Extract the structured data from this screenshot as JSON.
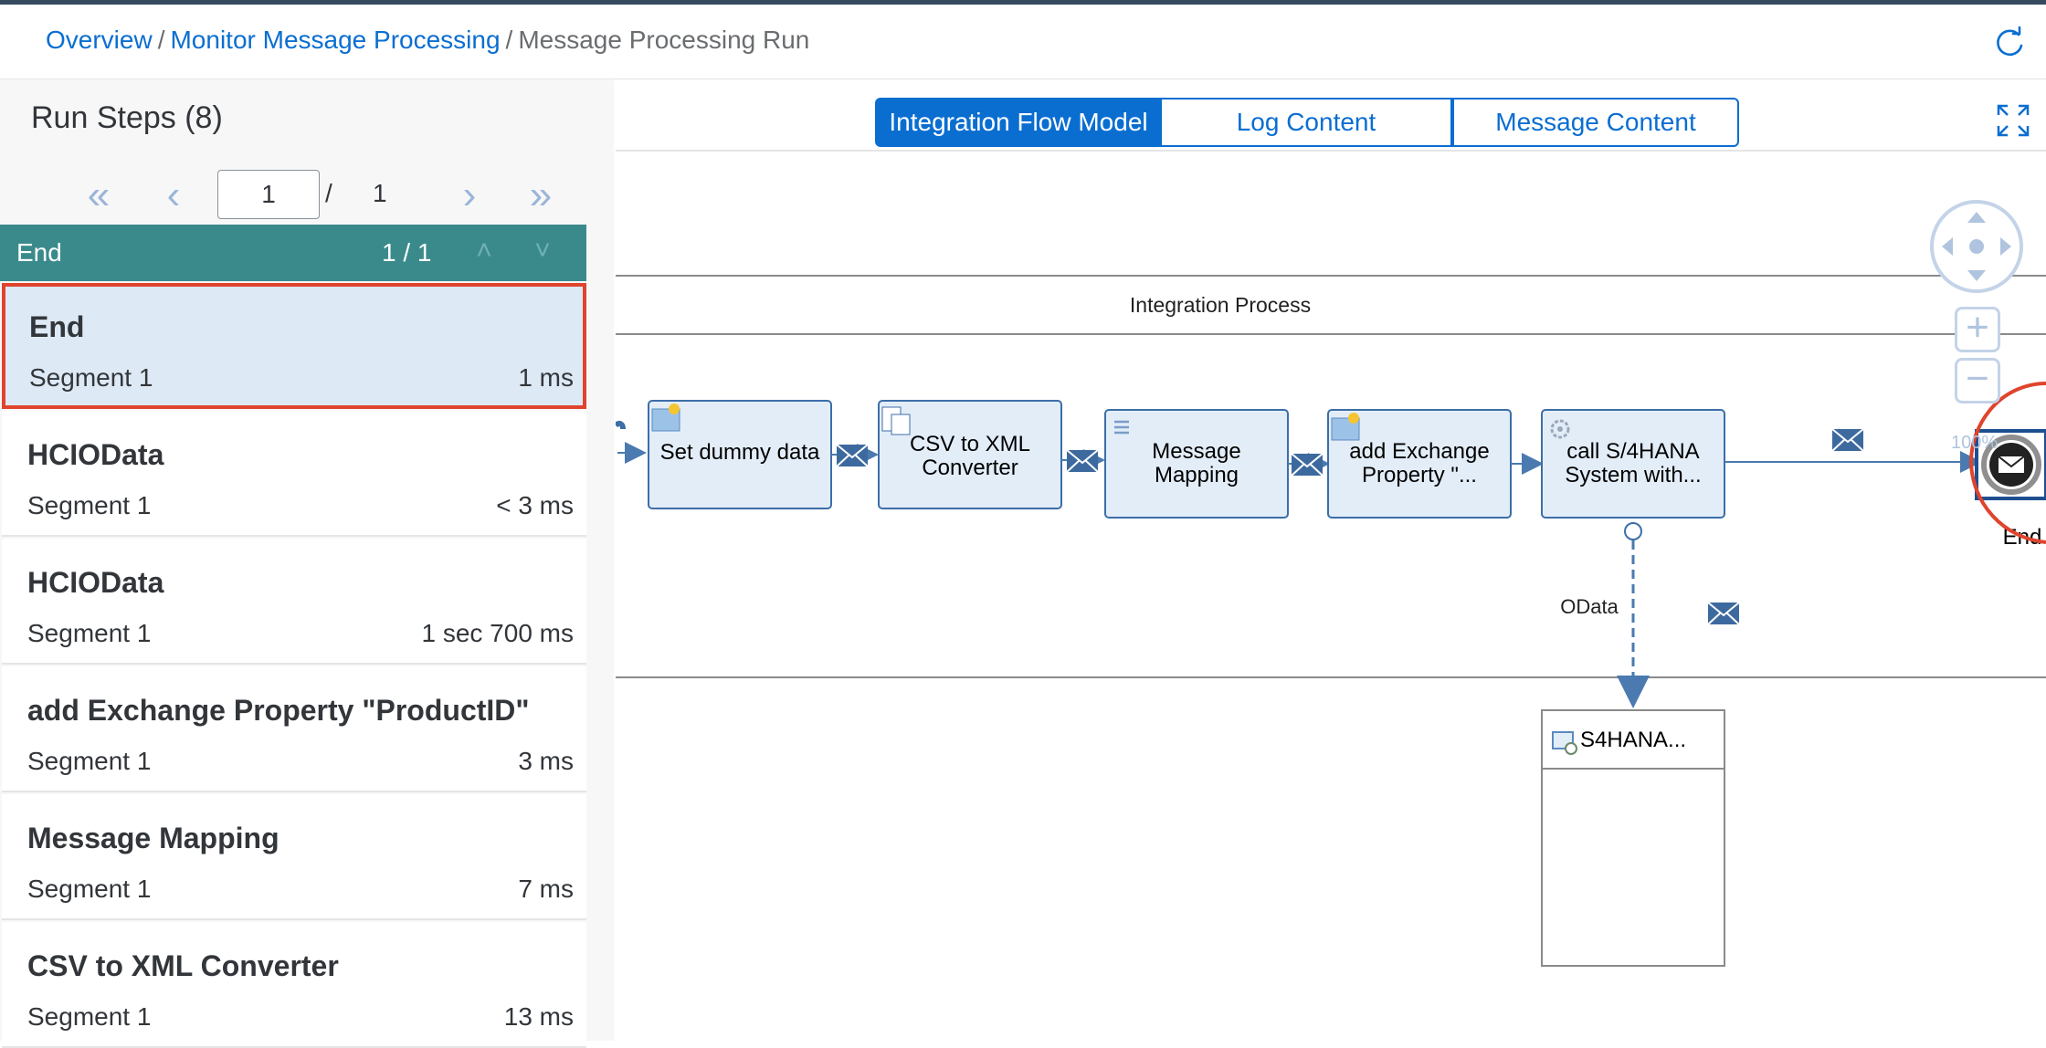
{
  "breadcrumb": {
    "overview": "Overview",
    "monitor": "Monitor Message Processing",
    "current": "Message Processing Run",
    "separator": "/"
  },
  "left_panel": {
    "title": "Run Steps (8)",
    "pager": {
      "current_page": "1",
      "separator": "/",
      "total_pages": "1"
    },
    "group": {
      "title": "End",
      "count": "1 / 1"
    },
    "items": [
      {
        "title": "End",
        "segment": "Segment 1",
        "time": "1 ms",
        "selected": true
      },
      {
        "title": "HCIOData",
        "segment": "Segment 1",
        "time": "< 3 ms"
      },
      {
        "title": "HCIOData",
        "segment": "Segment 1",
        "time": "1 sec 700 ms"
      },
      {
        "title": "add Exchange Property \"ProductID\"",
        "segment": "Segment 1",
        "time": "3 ms"
      },
      {
        "title": "Message Mapping",
        "segment": "Segment 1",
        "time": "7 ms"
      },
      {
        "title": "CSV to XML Converter",
        "segment": "Segment 1",
        "time": "13 ms"
      }
    ]
  },
  "tabs": [
    {
      "label": "Integration Flow Model",
      "active": true
    },
    {
      "label": "Log Content"
    },
    {
      "label": "Message Content"
    }
  ],
  "diagram": {
    "pool_label": "Integration Process",
    "steps": [
      {
        "label_lines": [
          "Set dummy data"
        ]
      },
      {
        "label_lines": [
          "CSV to XML",
          "Converter"
        ]
      },
      {
        "label_lines": [
          "Message",
          "Mapping"
        ]
      },
      {
        "label_lines": [
          "add Exchange",
          "Property \"..."
        ]
      },
      {
        "label_lines": [
          "call S/4HANA",
          "System with..."
        ]
      }
    ],
    "end_label": "End",
    "odata_label": "OData",
    "receiver_label": "S4HANA...",
    "zoom_label": "100%"
  },
  "colors": {
    "accent": "#0a6ed1",
    "group_bar": "#3a8a8c",
    "selected_border": "#e0442d",
    "step_fill": "#e3edf8",
    "step_stroke": "#3c6ea8",
    "flow": "#4a7ab0",
    "highlight_circle": "#e0442d"
  },
  "icons": {
    "refresh": "refresh-icon",
    "fullscreen": "fullscreen-icon",
    "first": "double-chevron-left-icon",
    "prev": "chevron-left-icon",
    "next": "chevron-right-icon",
    "last": "double-chevron-right-icon",
    "message": "envelope-icon"
  }
}
